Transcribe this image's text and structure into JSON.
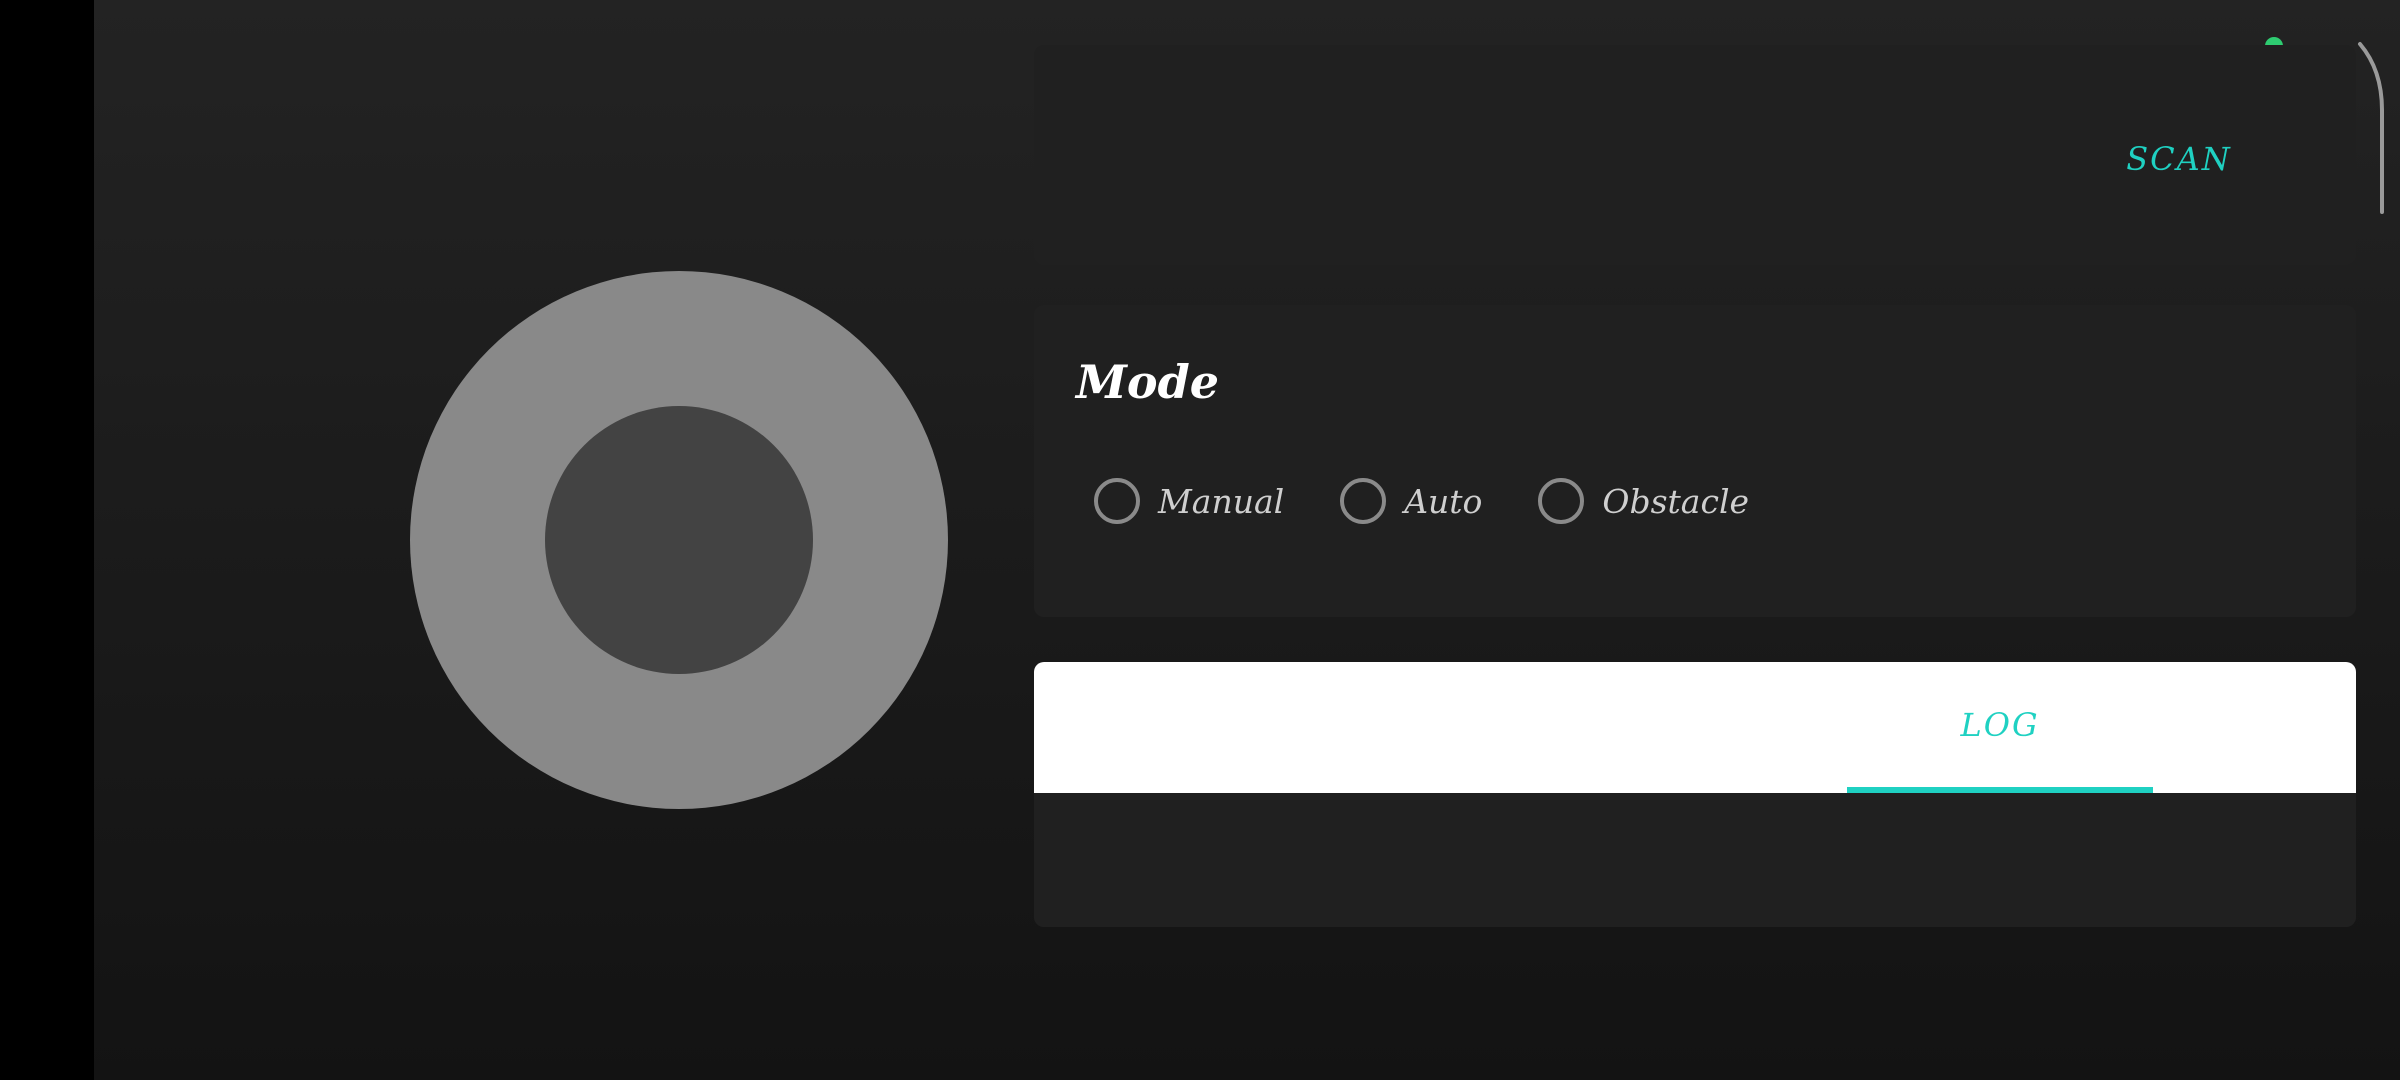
{
  "colors": {
    "background": "#1b1b1b",
    "card": "#202020",
    "accent": "#1fd1c2",
    "status": "#2ecc71",
    "joystick_outer": "#898989",
    "joystick_knob": "#434343"
  },
  "joystick": {
    "icon": "joystick"
  },
  "scan": {
    "button_label": "SCAN"
  },
  "status": {
    "icon": "connection-dot"
  },
  "mode": {
    "title": "Mode",
    "options": [
      {
        "label": "Manual",
        "selected": false
      },
      {
        "label": "Auto",
        "selected": false
      },
      {
        "label": "Obstacle",
        "selected": false
      }
    ]
  },
  "log": {
    "tab_label": "LOG",
    "content": ""
  }
}
